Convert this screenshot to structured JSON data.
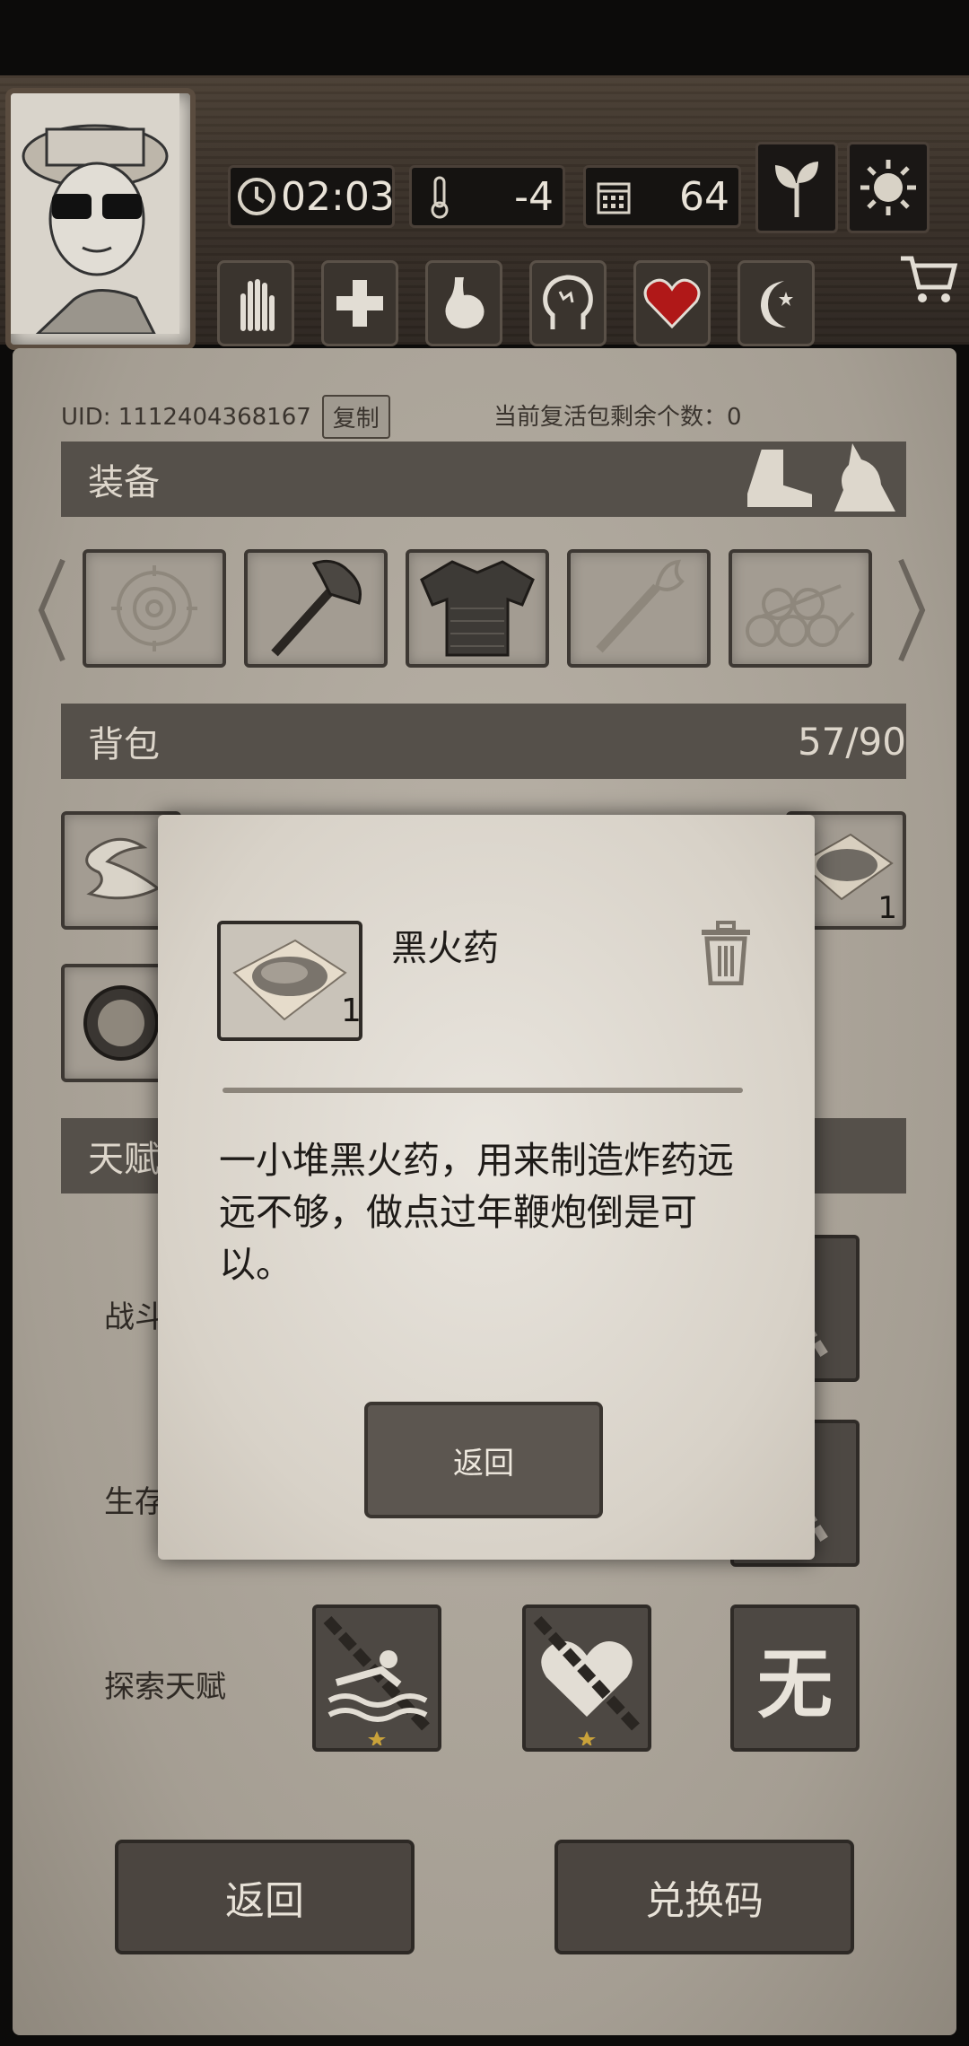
{
  "header": {
    "time": "02:03",
    "temperature": "-4",
    "days": "64",
    "icons": [
      "sprout-icon",
      "sun-icon"
    ],
    "status_icons": [
      "hand-icon",
      "health-cross-icon",
      "stomach-icon",
      "brain-icon",
      "heart-icon",
      "moon-icon"
    ]
  },
  "profile": {
    "uid_label": "UID: 1112404368167",
    "copy_label": "复制",
    "revive_label": "当前复活包剩余个数：0"
  },
  "equipment": {
    "title": "装备",
    "slots": [
      "target-icon",
      "axe-icon",
      "armor-vest-icon",
      "torch-icon",
      "logs-icon"
    ]
  },
  "backpack": {
    "title": "背包",
    "capacity": "57/90",
    "visible_item_count": "1"
  },
  "talents": {
    "title": "天赋",
    "rows": [
      {
        "label": "战斗天赋"
      },
      {
        "label": "生存天赋"
      },
      {
        "label": "探索天赋",
        "third_box_text": "无"
      }
    ]
  },
  "bottom": {
    "back_label": "返回",
    "redeem_label": "兑换码"
  },
  "dialog": {
    "item_name": "黑火药",
    "item_count": "1",
    "description": "一小堆黑火药，用来制造炸药远远不够，做点过年鞭炮倒是可以。",
    "back_label": "返回"
  },
  "colors": {
    "panel": "#aca59b",
    "section_bar": "#55504a",
    "dialog": "#ddd8cf",
    "heart": "#b01818"
  }
}
